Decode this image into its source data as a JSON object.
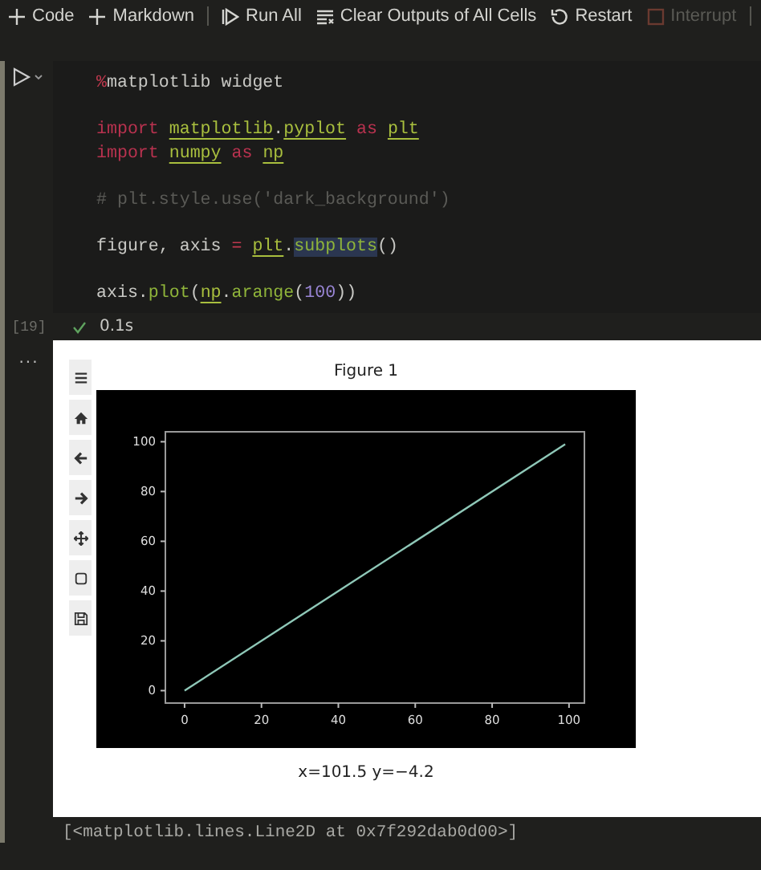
{
  "toolbar": [
    {
      "label": "Code",
      "disabled": false,
      "separator_before": false
    },
    {
      "label": "Markdown",
      "disabled": false,
      "separator_before": false
    },
    {
      "label": "Run All",
      "disabled": false,
      "separator_before": true
    },
    {
      "label": "Clear Outputs of All Cells",
      "disabled": false,
      "separator_before": false
    },
    {
      "label": "Restart",
      "disabled": false,
      "separator_before": false
    },
    {
      "label": "Interrupt",
      "disabled": true,
      "separator_before": false
    }
  ],
  "cell": {
    "execution_count": "[19]",
    "status": "0.1s",
    "more": "...",
    "code_blocks": [
      [
        [
          {
            "text": "%",
            "kind": "magic"
          },
          {
            "text": "matplotlib widget",
            "kind": "plain"
          }
        ]
      ],
      [
        [
          {
            "text": "import ",
            "kind": "keyword"
          },
          {
            "text": "matplotlib",
            "kind": "module"
          },
          {
            "text": ".",
            "kind": "plain"
          },
          {
            "text": "pyplot",
            "kind": "module"
          },
          {
            "text": " as ",
            "kind": "keyword"
          },
          {
            "text": "plt",
            "kind": "module"
          }
        ],
        [
          {
            "text": "import ",
            "kind": "keyword"
          },
          {
            "text": "numpy",
            "kind": "module"
          },
          {
            "text": " as ",
            "kind": "keyword"
          },
          {
            "text": "np",
            "kind": "module"
          }
        ]
      ],
      [
        [
          {
            "text": "# plt.style.use('dark_background')",
            "kind": "comment"
          }
        ]
      ],
      [
        [
          {
            "text": "figure, axis ",
            "kind": "plain"
          },
          {
            "text": "= ",
            "kind": "operator"
          },
          {
            "text": "plt",
            "kind": "module"
          },
          {
            "text": ".",
            "kind": "plain"
          },
          {
            "text": "subplots",
            "kind": "highlight"
          },
          {
            "text": "()",
            "kind": "plain"
          }
        ]
      ],
      [
        [
          {
            "text": "axis.",
            "kind": "plain"
          },
          {
            "text": "plot",
            "kind": "function"
          },
          {
            "text": "(",
            "kind": "plain"
          },
          {
            "text": "np",
            "kind": "module"
          },
          {
            "text": ".",
            "kind": "plain"
          },
          {
            "text": "arange",
            "kind": "function"
          },
          {
            "text": "(",
            "kind": "plain"
          },
          {
            "text": "100",
            "kind": "number"
          },
          {
            "text": "))",
            "kind": "plain"
          }
        ]
      ]
    ],
    "figure": {
      "title": "Figure 1",
      "status": "x=101.5 y=−4.2",
      "chart_data": {
        "type": "line",
        "x": [
          0,
          99
        ],
        "series": [
          {
            "color": "#8fc8b8",
            "values": [
              0,
              99
            ]
          }
        ],
        "xlim": [
          -5,
          104
        ],
        "ylim": [
          -5,
          104
        ],
        "xticks": [
          0,
          20,
          40,
          60,
          80,
          100
        ],
        "yticks": [
          0,
          20,
          40,
          60,
          80,
          100
        ]
      }
    },
    "output_text": "[<matplotlib.lines.Line2D at 0x7f292dab0d00>]"
  }
}
